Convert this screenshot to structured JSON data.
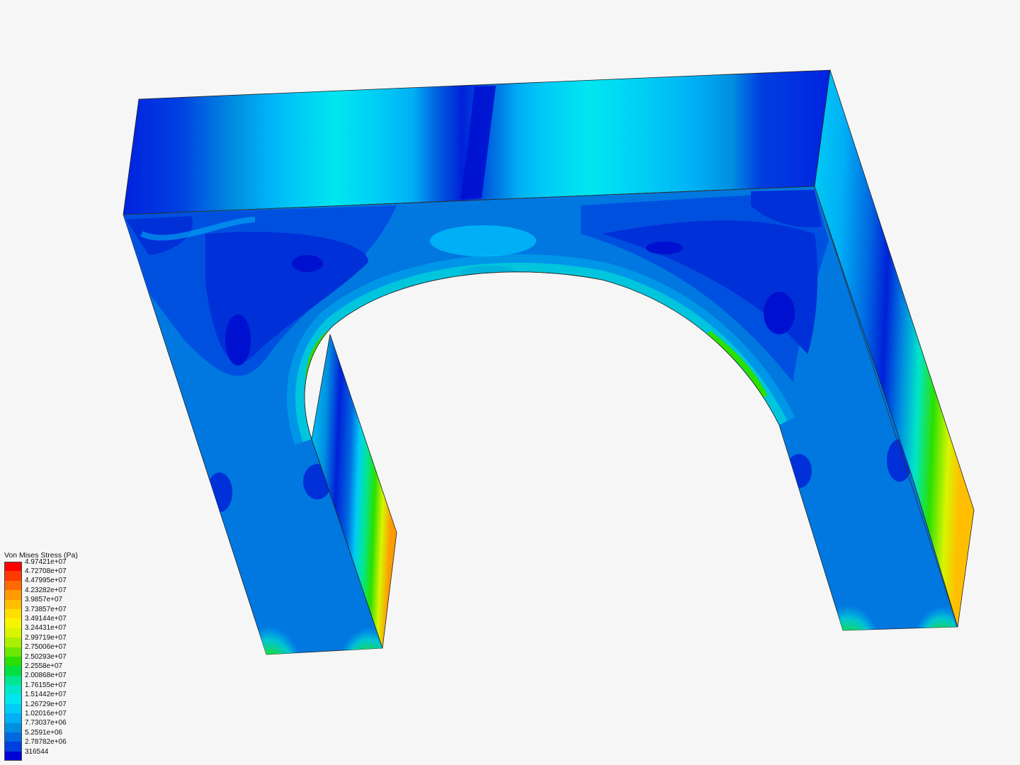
{
  "legend": {
    "title": "Von Mises Stress (Pa)",
    "entries": [
      {
        "label": "4.97421e+07",
        "color": "#ff0000"
      },
      {
        "label": "4.72708e+07",
        "color": "#ff3a00"
      },
      {
        "label": "4.47995e+07",
        "color": "#ff6a00"
      },
      {
        "label": "4.23282e+07",
        "color": "#ff9a00"
      },
      {
        "label": "3.9857e+07",
        "color": "#ffbf00"
      },
      {
        "label": "3.73857e+07",
        "color": "#ffdf00"
      },
      {
        "label": "3.49144e+07",
        "color": "#f5f500"
      },
      {
        "label": "3.24431e+07",
        "color": "#d8f500"
      },
      {
        "label": "2.99719e+07",
        "color": "#aaf000"
      },
      {
        "label": "2.75006e+07",
        "color": "#6ae800"
      },
      {
        "label": "2.50293e+07",
        "color": "#2ae000"
      },
      {
        "label": "2.2558e+07",
        "color": "#00e040"
      },
      {
        "label": "2.00868e+07",
        "color": "#00e690"
      },
      {
        "label": "1.76155e+07",
        "color": "#00e6c8"
      },
      {
        "label": "1.51442e+07",
        "color": "#00e6f0"
      },
      {
        "label": "1.26729e+07",
        "color": "#00cdf5"
      },
      {
        "label": "1.02016e+07",
        "color": "#00aff5"
      },
      {
        "label": "7.73037e+06",
        "color": "#0090e0"
      },
      {
        "label": "5.2591e+06",
        "color": "#0068e0"
      },
      {
        "label": "2.78782e+06",
        "color": "#0040e0"
      },
      {
        "label": "316544",
        "color": "#0000d8"
      }
    ]
  },
  "colors": {
    "background": "#f6f6f6",
    "deep_blue": "#0012d8",
    "blue": "#0040e0",
    "mid_blue": "#0068e0",
    "light_blue": "#0090e0",
    "sky": "#00aff5",
    "cyan": "#00cdf5",
    "bright_cyan": "#00e6f0",
    "teal": "#00e6c8",
    "green": "#2ae000",
    "yellow": "#e8f000",
    "orange": "#ff9a00",
    "red": "#e03000"
  }
}
